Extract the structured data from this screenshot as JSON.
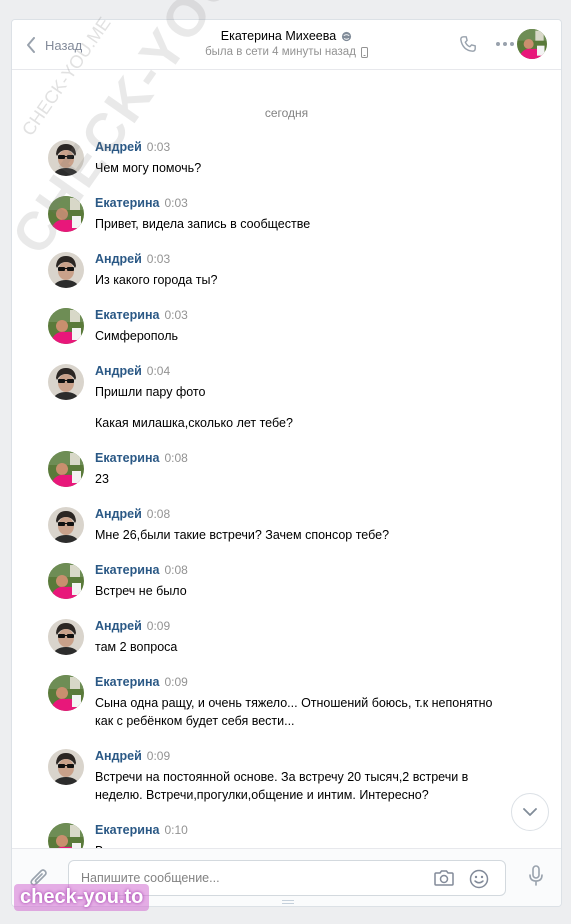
{
  "header": {
    "back_label": "Назад",
    "peer_name": "Екатерина Михеева",
    "status": "была в сети 4 минуты назад"
  },
  "history": {
    "date_separator": "сегодня",
    "messages": [
      {
        "author": "Андрей",
        "time": "0:03",
        "text": "Чем могу помочь?",
        "who": "andrey"
      },
      {
        "author": "Екатерина",
        "time": "0:03",
        "text": "Привет, видела запись в сообществе",
        "who": "ekaterina"
      },
      {
        "author": "Андрей",
        "time": "0:03",
        "text": "Из какого города ты?",
        "who": "andrey"
      },
      {
        "author": "Екатерина",
        "time": "0:03",
        "text": "Симферополь",
        "who": "ekaterina"
      },
      {
        "author": "Андрей",
        "time": "0:04",
        "text": "Пришли пару фото",
        "text2": "Какая милашка,сколько лет тебе?",
        "who": "andrey"
      },
      {
        "author": "Екатерина",
        "time": "0:08",
        "text": "23",
        "who": "ekaterina"
      },
      {
        "author": "Андрей",
        "time": "0:08",
        "text": "Мне 26,были такие встречи? Зачем спонсор тебе?",
        "who": "andrey"
      },
      {
        "author": "Екатерина",
        "time": "0:08",
        "text": "Встреч не было",
        "who": "ekaterina"
      },
      {
        "author": "Андрей",
        "time": "0:09",
        "text": "там 2 вопроса",
        "who": "andrey"
      },
      {
        "author": "Екатерина",
        "time": "0:09",
        "text": "Сына одна ращу, и очень тяжело... Отношений боюсь, т.к непонятно как с ребёнком будет себя вести...",
        "who": "ekaterina"
      },
      {
        "author": "Андрей",
        "time": "0:09",
        "text": "Встречи на постоянной основе. За встречу 20 тысяч,2 встречи в неделю. Встречи,прогулки,общение и интим. Интересно?",
        "who": "andrey"
      },
      {
        "author": "Екатерина",
        "time": "0:10",
        "text": "В принципе да",
        "who": "ekaterina"
      }
    ]
  },
  "composer": {
    "placeholder": "Напишите сообщение..."
  },
  "watermarks": {
    "diagonal": "CHECK-YOU.ME",
    "small": "CHECK-YOU.ME",
    "badge": "check-you.to"
  },
  "colors": {
    "author": "#2a5885",
    "muted": "#939393",
    "panel_bg": "#ffffff",
    "page_bg": "#edeef0"
  },
  "icons": [
    "chevron-left-icon",
    "globe-icon",
    "mobile-phone-icon",
    "phone-icon",
    "more-dots-icon",
    "paperclip-icon",
    "camera-icon",
    "smile-icon",
    "microphone-icon",
    "chevron-down-icon"
  ]
}
